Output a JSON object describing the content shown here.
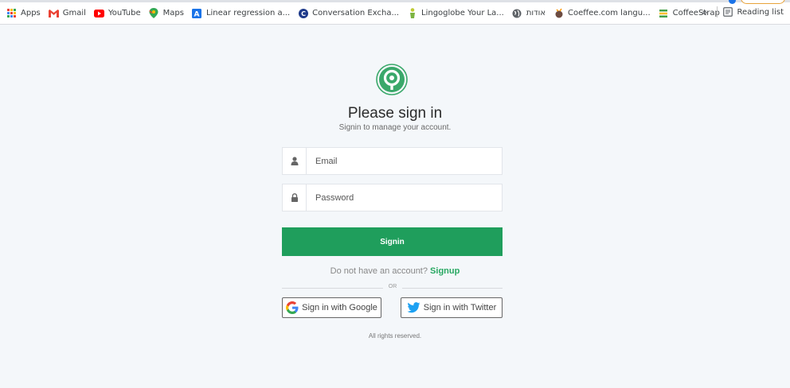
{
  "bookmarks": {
    "items": [
      {
        "label": "Apps",
        "icon": "apps-grid-icon",
        "color": "#ea4335"
      },
      {
        "label": "Gmail",
        "icon": "gmail-icon",
        "color": "#ea4335"
      },
      {
        "label": "YouTube",
        "icon": "youtube-icon",
        "color": "#ff0000"
      },
      {
        "label": "Maps",
        "icon": "maps-icon",
        "color": "#34a853"
      },
      {
        "label": "Linear regression a...",
        "icon": "letter-a-icon",
        "color": "#1a73e8"
      },
      {
        "label": "Conversation Excha...",
        "icon": "letter-c-icon",
        "color": "#1e3a8a"
      },
      {
        "label": "Lingoglobe Your La...",
        "icon": "figure-icon",
        "color": "#7cb342"
      },
      {
        "label": "אודות",
        "icon": "globe-icon",
        "color": "#3c4043"
      },
      {
        "label": "Coeffee.com langu...",
        "icon": "coffee-icon",
        "color": "#6d4c41"
      },
      {
        "label": "CoffeeStrap",
        "icon": "stack-icon",
        "color": "#43a047"
      }
    ],
    "overflow": "»",
    "reading_list": "Reading list"
  },
  "signin": {
    "title": "Please sign in",
    "subtitle": "Signin to manage your account.",
    "email_placeholder": "Email",
    "password_placeholder": "Password",
    "submit_label": "Signin",
    "no_account_text": "Do not have an account?",
    "signup_link": "Signup",
    "or_text": "OR",
    "google_label": "Sign in with Google",
    "twitter_label": "Sign in with Twitter",
    "footer": "All rights reserved."
  },
  "colors": {
    "accent": "#1f9e5c",
    "link": "#28a862",
    "logo": "#3aa86a",
    "twitter": "#1da1f2"
  }
}
